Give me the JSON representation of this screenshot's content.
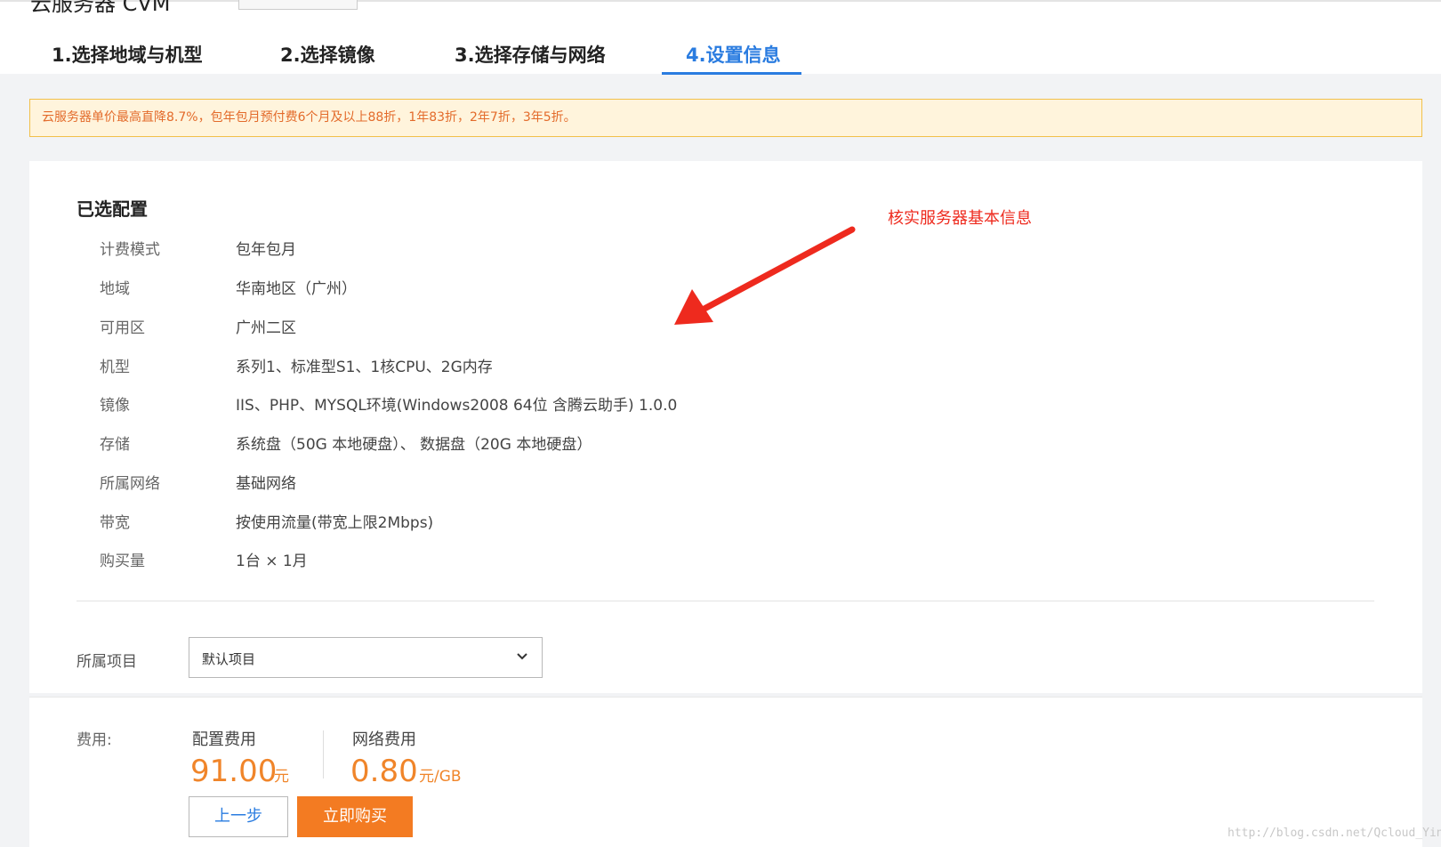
{
  "header": {
    "title": "云服务器 CVM",
    "tabs": [
      {
        "label": "1.选择地域与机型"
      },
      {
        "label": "2.选择镜像"
      },
      {
        "label": "3.选择存储与网络"
      },
      {
        "label": "4.设置信息"
      }
    ],
    "active_tab": 3
  },
  "notice": "云服务器单价最高直降8.7%，包年包月预付费6个月及以上88折，1年83折，2年7折，3年5折。",
  "config": {
    "title": "已选配置",
    "rows": [
      {
        "label": "计费模式",
        "value": "包年包月"
      },
      {
        "label": "地域",
        "value": "华南地区（广州）"
      },
      {
        "label": "可用区",
        "value": "广州二区"
      },
      {
        "label": "机型",
        "value": "系列1、标准型S1、1核CPU、2G内存"
      },
      {
        "label": "镜像",
        "value": "IIS、PHP、MYSQL环境(Windows2008 64位 含腾云助手) 1.0.0"
      },
      {
        "label": "存储",
        "value": "系统盘（50G 本地硬盘）、 数据盘（20G 本地硬盘）"
      },
      {
        "label": "所属网络",
        "value": "基础网络"
      },
      {
        "label": "带宽",
        "value": "按使用流量(带宽上限2Mbps)"
      },
      {
        "label": "购买量",
        "value": "1台 × 1月"
      }
    ]
  },
  "annotation": {
    "text": "核实服务器基本信息",
    "color": "#ee2a1e"
  },
  "project": {
    "label": "所属项目",
    "selected": "默认项目",
    "icon": "chevron-down-icon"
  },
  "fees": {
    "label": "费用:",
    "config_fee": {
      "title": "配置费用",
      "amount": "91.00",
      "unit": "元"
    },
    "network_fee": {
      "title": "网络费用",
      "amount": "0.80",
      "unit": "元/GB"
    }
  },
  "buttons": {
    "prev": "上一步",
    "buy": "立即购买"
  },
  "watermark": "http://blog.csdn.net/Qcloud_Yingjoy",
  "colors": {
    "accent": "#2a7ce0",
    "price": "#f0852a",
    "buy_button": "#f37b22",
    "notice_bg": "#fff4dc",
    "notice_text": "#e36b2b"
  }
}
